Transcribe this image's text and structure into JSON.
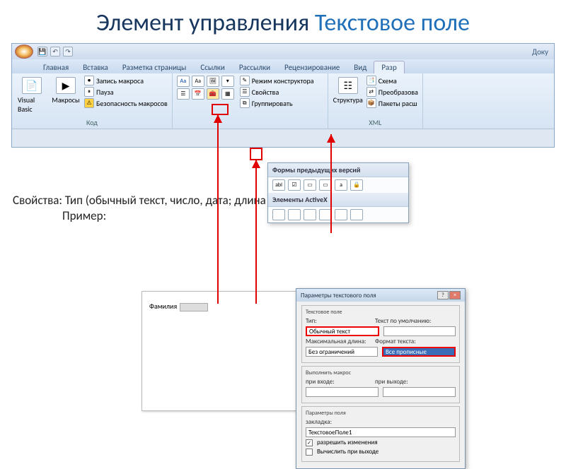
{
  "slide": {
    "title_plain": "Элемент управления ",
    "title_accent": "Текстовое поле",
    "properties_line": "Свойства: Тип (обычный текст, число, дата; длина – кол-во символов)",
    "example_label": "Пример:"
  },
  "titlebar": {
    "doc_label": "Доку"
  },
  "qat": {
    "save": "💾",
    "undo": "↶",
    "redo": "↷"
  },
  "tabs": {
    "home": "Главная",
    "insert": "Вставка",
    "pagelayout": "Разметка страницы",
    "references": "Ссылки",
    "mailings": "Рассылки",
    "review": "Рецензирование",
    "view": "Вид",
    "developer": "Разр"
  },
  "ribbon": {
    "code": {
      "visual_basic": "Visual Basic",
      "macros": "Макросы",
      "record": "Запись макроса",
      "pause": "Пауза",
      "security": "Безопасность макросов",
      "group": "Код"
    },
    "controls": {
      "aa1": "Aa",
      "aa2": "Aa",
      "design_mode": "Режим конструктора",
      "properties": "Свойства",
      "group_cmd": "Группировать"
    },
    "structure": {
      "btn": "Структура",
      "schema": "Схема",
      "transform": "Преобразова",
      "packages": "Пакеты расш",
      "group": "XML"
    }
  },
  "dropdown": {
    "legacy_header": "Формы предыдущих версий",
    "abl": "abl",
    "activex_header": "Элементы ActiveX"
  },
  "form": {
    "field_label": "Фамилия"
  },
  "dialog": {
    "title": "Параметры текстового поля",
    "fs_textfield": "Текстовое поле",
    "type_label": "Тип:",
    "type_value": "Обычный текст",
    "default_label": "Текст по умолчанию:",
    "maxlen_label": "Максимальная длина:",
    "maxlen_value": "Без ограничений",
    "format_label": "Формат текста:",
    "format_value": "Все прописные",
    "fs_macro": "Выполнить макрос",
    "on_enter": "при входе:",
    "on_exit": "при выходе:",
    "fs_field": "Параметры поля",
    "bookmark_label": "закладка:",
    "bookmark_value": "ТекстовоеПоле1",
    "allow_changes": "разрешить изменения",
    "calc_on_exit": "Вычислить при выходе"
  }
}
